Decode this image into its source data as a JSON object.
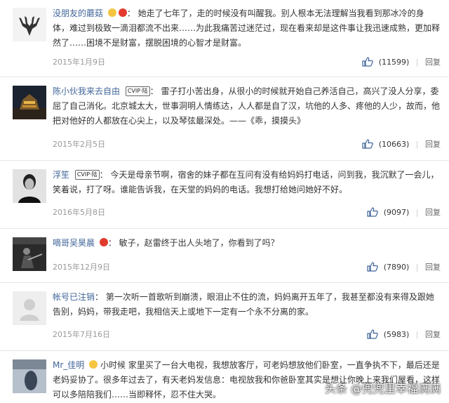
{
  "comments": [
    {
      "user": "没朋友的蘑菇",
      "badge": "",
      "has_emoji": true,
      "content": "她走了七年了，走的时候没有叫醒我。别人根本无法理解当我看到那冰冷的身体，难过到极致一滴泪都流不出来……为此我痛苦过迷茫过，现在看来却是这件事让我迅速成熟，更加释然了……困境不是财富，摆脱困境的心智才是财富。",
      "date": "2015年1月9日",
      "likes": "(11599)",
      "reply": "回复"
    },
    {
      "user": "陈小伙我来去自由",
      "badge": "CVIP·陆",
      "has_emoji": false,
      "content": "雷子打小苦出身，从很小的时候就开始自己养活自己，高兴了没人分享，委屈了自己消化。北京城太大，世事洞明人情练达，人人都是自了汉，坑他的人多、疼他的人少，故而，他把对他好的人都放在心尖上，以及琴弦最深处。——《乖，摸摸头》",
      "date": "2015年2月5日",
      "likes": "(10663)",
      "reply": "回复"
    },
    {
      "user": "浮笙",
      "badge": "CVIP·陆",
      "has_emoji": false,
      "content": "今天是母亲节啊，宿舍的妹子都在互问有没有给妈妈打电话，问到我，我沉默了一会儿，笑着说，打了呀。谁能告诉我，在天堂的妈妈的电话。我想打给她问她好不好。",
      "date": "2016年5月8日",
      "likes": "(9097)",
      "reply": "回复"
    },
    {
      "user": "嘀哥吴昊晨",
      "badge": "",
      "has_emoji": true,
      "content": "敏子，赵雷终于出人头地了，你看到了吗？",
      "date": "2015年12月9日",
      "likes": "(7890)",
      "reply": "回复"
    },
    {
      "user": "帐号已注销",
      "badge": "",
      "has_emoji": false,
      "content": "第一次听一首歌听到崩溃，眼泪止不住的流，妈妈离开五年了，我甚至都没有来得及跟她告别，妈妈，带我走吧，我相信天上或地下一定有一个永不分离的家。",
      "date": "2015年7月16日",
      "likes": "(5983)",
      "reply": "回复"
    },
    {
      "user": "Mr_佳明",
      "badge": "",
      "has_emoji": true,
      "content": "小时候 家里买了一台大电视，我想放客厅，可老妈想放他们卧室，一直争执不下，最后还是老妈妥协了。很多年过去了，有天老妈发信息：电视放我和你爸卧室其实是想让你晚上来我们屋看，这样可以多陪陪我们……当即释怀，忍不住大哭。",
      "date": "",
      "likes": "",
      "reply": ""
    }
  ],
  "watermark": "头条 @兜兜里幸福满满"
}
